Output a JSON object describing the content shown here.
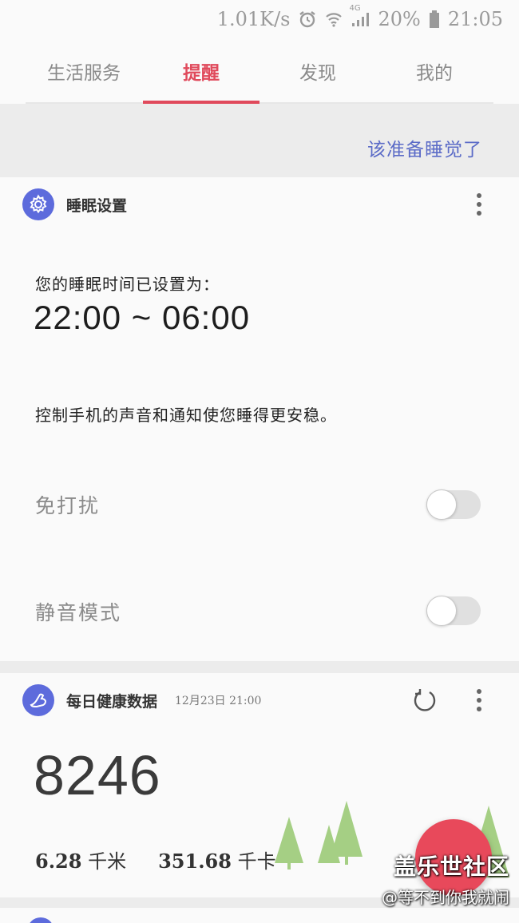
{
  "status_bar": {
    "net_speed": "1.01K/s",
    "network_type": "4G",
    "battery": "20%",
    "time": "21:05",
    "icons": [
      "alarm-icon",
      "wifi-icon",
      "signal-icon",
      "battery-icon"
    ]
  },
  "tabs": [
    {
      "label": "生活服务",
      "active": false
    },
    {
      "label": "提醒",
      "active": true
    },
    {
      "label": "发现",
      "active": false
    },
    {
      "label": "我的",
      "active": false
    }
  ],
  "header_hint": "该准备睡觉了",
  "sleep_card": {
    "title": "睡眠设置",
    "icon": "gear-icon",
    "label": "您的睡眠时间已设置为：",
    "time_range": "22:00 ~ 06:00",
    "description": "控制手机的声音和通知使您睡得更安稳。",
    "toggles": [
      {
        "label": "免打扰",
        "on": false
      },
      {
        "label": "静音模式",
        "on": false
      }
    ]
  },
  "health_card": {
    "title": "每日健康数据",
    "icon": "shoe-icon",
    "timestamp": "12月23日  21:00",
    "steps": "8246",
    "distance_value": "6.28",
    "distance_unit": "千米",
    "calories_value": "351.68",
    "calories_unit": "千卡"
  },
  "watermark": {
    "line1": "盖乐世社区",
    "line2": "@等不到你我就闹"
  },
  "colors": {
    "accent": "#e04a5c",
    "icon_badge": "#5d6bdc",
    "hint_text": "#5b6bc7",
    "fab": "#e8495b",
    "tree": "#a5cf84"
  }
}
